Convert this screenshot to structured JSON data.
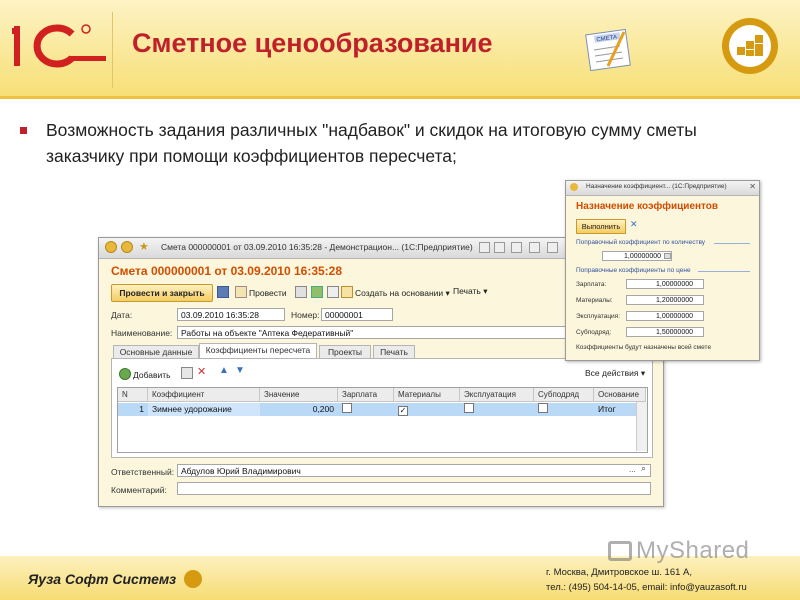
{
  "slide": {
    "title": "Сметное ценообразование",
    "bullet_text": "Возможность задания различных \"надбавок\" и скидок на итоговую сумму сметы заказчику при помощи коэффициентов пересчета;",
    "smeta_icon_label": "СМЕТА",
    "accent_color": "#c0202a",
    "header_color": "#f7df77"
  },
  "window": {
    "title": "Смета 000000001 от 03.09.2010 16:35:28 - Демонстрацион... (1С:Предприятие)",
    "doc_title": "Смета 000000001 от 03.09.2010 16:35:28",
    "toolbar": {
      "post_close": "Провести и закрыть",
      "post": "Провести",
      "create_basis": "Создать на основании",
      "print": "Печать"
    },
    "date_label": "Дата:",
    "date_value": "03.09.2010 16:35:28",
    "number_label": "Номер:",
    "number_value": "00000001",
    "name_label": "Наименование:",
    "name_value": "Работы на объекте \"Аптека Федеративный\"",
    "tabs": [
      "Основные данные",
      "Коэффициенты пересчета",
      "Проекты",
      "Печать"
    ],
    "grid_toolbar": {
      "add": "Добавить",
      "all_actions": "Все действия"
    },
    "columns": [
      "N",
      "Коэффициент",
      "Значение",
      "Зарплата",
      "Материалы",
      "Эксплуатация",
      "Субподряд",
      "Основание"
    ],
    "rows": [
      {
        "n": "1",
        "coef": "Зимнее удорожание",
        "value": "0,200",
        "salary": false,
        "materials": true,
        "exploitation": false,
        "subcontract": false,
        "basis": "Итог"
      }
    ],
    "responsible_label": "Ответственный:",
    "responsible_value": "Абдулов Юрий Владимирович",
    "comment_label": "Комментарий:",
    "comment_value": ""
  },
  "dialog": {
    "title_bar": "Назначение коэффициент... (1С:Предприятие)",
    "title": "Назначение коэффициентов",
    "run_button": "Выполнить",
    "qty_section": "Поправочный коэффициент по количеству",
    "qty_value": "1,00000000",
    "price_section": "Поправочные коэффициенты по цене",
    "price_rows": [
      {
        "label": "Зарплата:",
        "value": "1,00000000"
      },
      {
        "label": "Материалы:",
        "value": "1,20000000"
      },
      {
        "label": "Эксплуатация:",
        "value": "1,00000000"
      },
      {
        "label": "Субподряд:",
        "value": "1,50000000"
      }
    ],
    "note": "Коэффициенты будут назначены всей смете"
  },
  "footer": {
    "brand": "Яуза Софт Системз",
    "address": "г. Москва, Дмитровское ш. 161 А,",
    "contacts": "тел.: (495) 504-14-05, email: info@yauzasoft.ru"
  },
  "watermark": "MyShared"
}
